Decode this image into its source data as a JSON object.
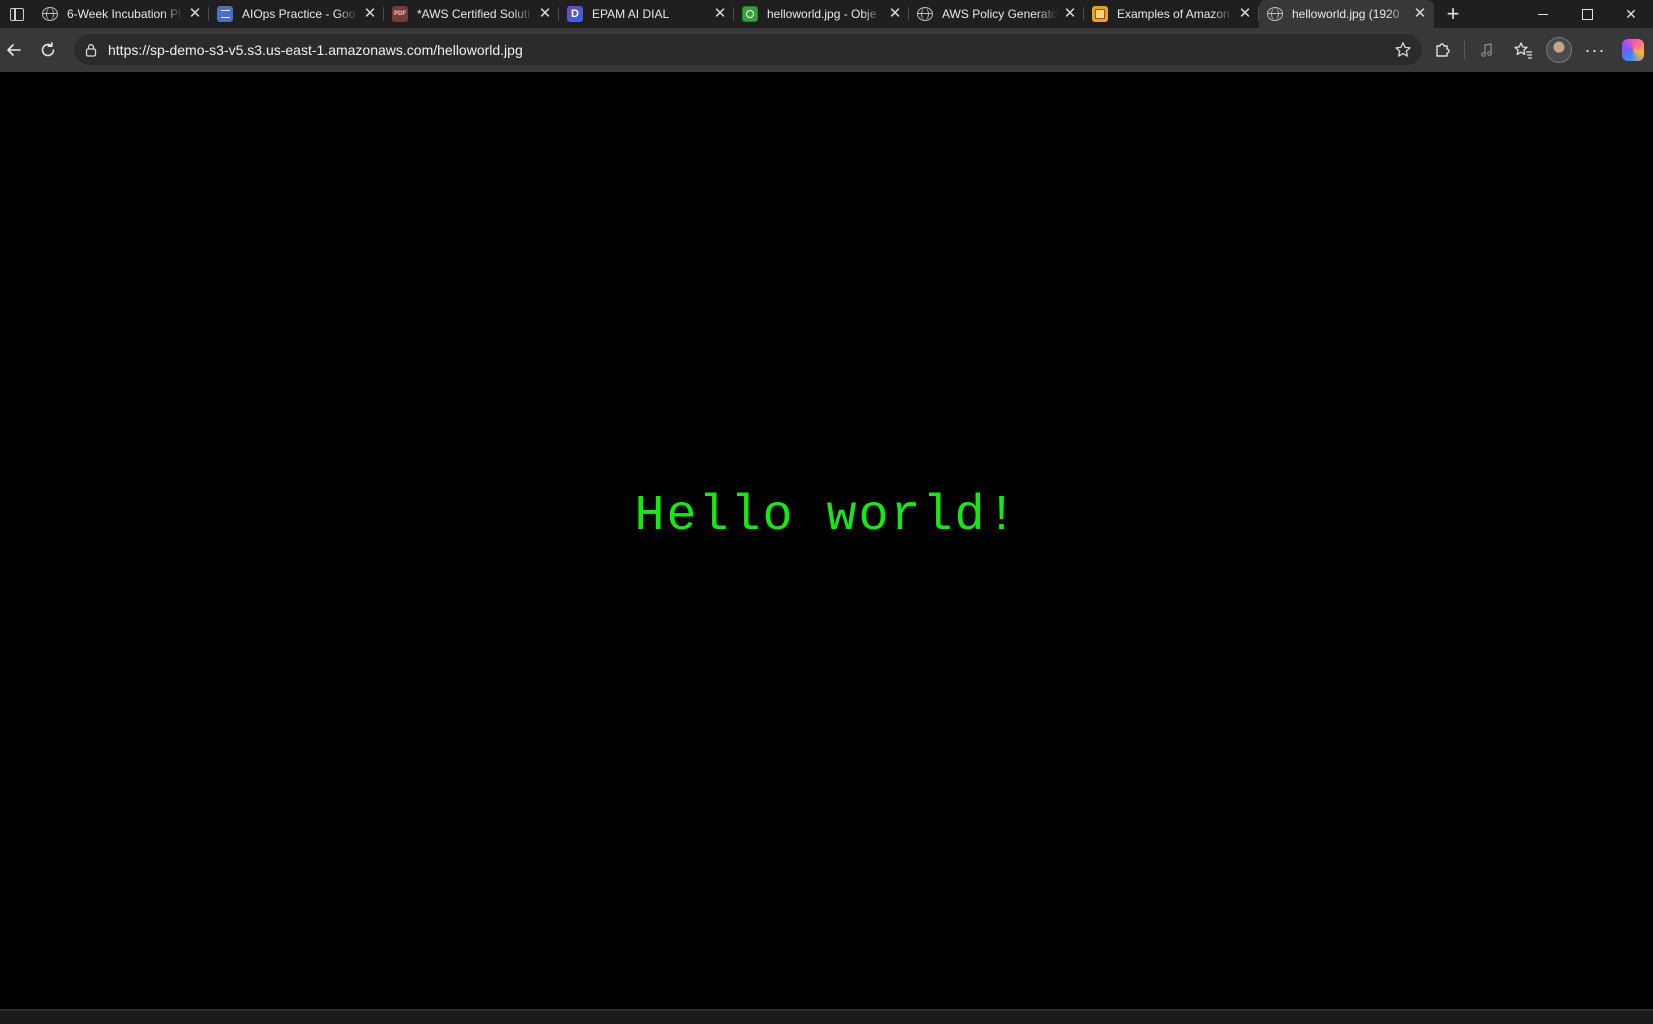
{
  "tabs": [
    {
      "title": "6-Week Incubation Pl",
      "favicon": "globe-icon"
    },
    {
      "title": "AIOps Practice - Goo",
      "favicon": "docs-icon"
    },
    {
      "title": "*AWS Certified Soluti",
      "favicon": "pdf-icon"
    },
    {
      "title": "EPAM AI DIAL",
      "favicon": "dial-icon"
    },
    {
      "title": "helloworld.jpg - Obje",
      "favicon": "s3-icon"
    },
    {
      "title": "AWS Policy Generator",
      "favicon": "globe-icon"
    },
    {
      "title": "Examples of Amazon",
      "favicon": "box-icon"
    },
    {
      "title": "helloworld.jpg (1920",
      "favicon": "globe-icon",
      "active": true
    }
  ],
  "address_bar": {
    "url": "https://sp-demo-s3-v5.s3.us-east-1.amazonaws.com/helloworld.jpg"
  },
  "page": {
    "image_text": "Hello world!"
  },
  "colors": {
    "text_green": "#19e619",
    "tab_strip": "#1f1f1f",
    "toolbar": "#383838",
    "address_field": "#2b2b2b"
  }
}
